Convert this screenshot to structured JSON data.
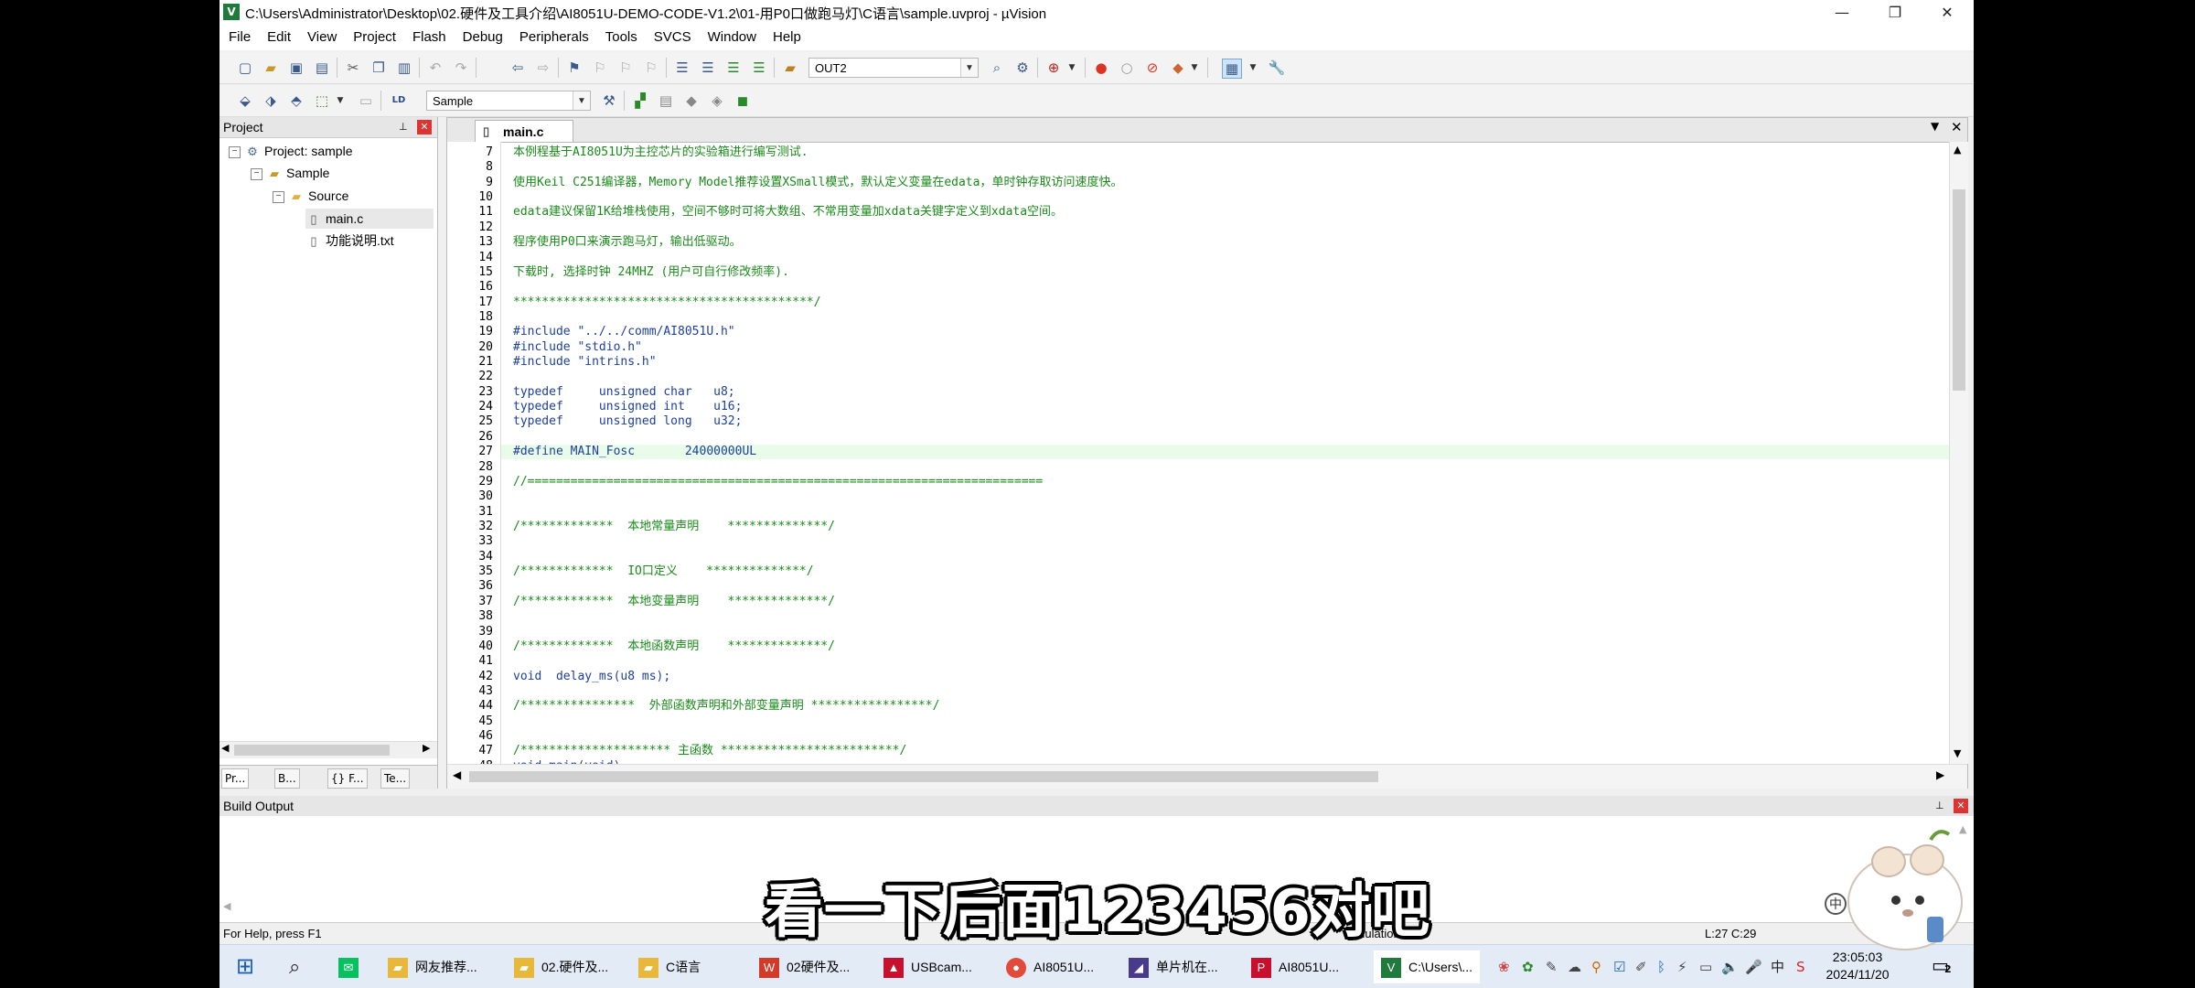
{
  "window": {
    "title": "C:\\Users\\Administrator\\Desktop\\02.硬件及工具介绍\\AI8051U-DEMO-CODE-V1.2\\01-用P0口做跑马灯\\C语言\\sample.uvproj - µVision",
    "minimize": "—",
    "maximize": "❐",
    "close": "✕"
  },
  "menu": [
    "File",
    "Edit",
    "View",
    "Project",
    "Flash",
    "Debug",
    "Peripherals",
    "Tools",
    "SVCS",
    "Window",
    "Help"
  ],
  "toolbar": {
    "target_combo": "OUT2",
    "target_select": "Sample"
  },
  "project": {
    "header": "Project",
    "root": "Project: sample",
    "group": "Sample",
    "folder": "Source",
    "files": [
      "main.c",
      "功能说明.txt"
    ],
    "tabs": [
      "Pr...",
      "B...",
      "{} F...",
      "Te..."
    ]
  },
  "editor": {
    "tab": "main.c",
    "cursor_line": 27,
    "lines": [
      {
        "n": "7",
        "cls": "c-green",
        "t": "本例程基于AI8051U为主控芯片的实验箱进行编写测试."
      },
      {
        "n": "8",
        "cls": "c-green",
        "t": ""
      },
      {
        "n": "9",
        "cls": "c-green",
        "t": "使用Keil C251编译器，Memory Model推荐设置XSmall模式，默认定义变量在edata，单时钟存取访问速度快。"
      },
      {
        "n": "10",
        "cls": "c-green",
        "t": ""
      },
      {
        "n": "11",
        "cls": "c-green",
        "t": "edata建议保留1K给堆栈使用，空间不够时可将大数组、不常用变量加xdata关键字定义到xdata空间。"
      },
      {
        "n": "12",
        "cls": "c-green",
        "t": ""
      },
      {
        "n": "13",
        "cls": "c-green",
        "t": "程序使用P0口来演示跑马灯，输出低驱动。"
      },
      {
        "n": "14",
        "cls": "c-green",
        "t": ""
      },
      {
        "n": "15",
        "cls": "c-green",
        "t": "下载时, 选择时钟 24MHZ (用户可自行修改频率)."
      },
      {
        "n": "16",
        "cls": "c-green",
        "t": ""
      },
      {
        "n": "17",
        "cls": "c-green",
        "t": "******************************************/"
      },
      {
        "n": "18",
        "cls": "c-black",
        "t": ""
      },
      {
        "n": "19",
        "cls": "c-blue",
        "t": "#include \"../../comm/AI8051U.h\""
      },
      {
        "n": "20",
        "cls": "c-blue",
        "t": "#include \"stdio.h\""
      },
      {
        "n": "21",
        "cls": "c-blue",
        "t": "#include \"intrins.h\""
      },
      {
        "n": "22",
        "cls": "c-black",
        "t": ""
      },
      {
        "n": "23",
        "cls": "c-blue",
        "t": "typedef     unsigned char   u8;"
      },
      {
        "n": "24",
        "cls": "c-blue",
        "t": "typedef     unsigned int    u16;"
      },
      {
        "n": "25",
        "cls": "c-blue",
        "t": "typedef     unsigned long   u32;"
      },
      {
        "n": "26",
        "cls": "c-black",
        "t": ""
      },
      {
        "n": "27",
        "cls": "c-blue",
        "t": "#define MAIN_Fosc       24000000UL"
      },
      {
        "n": "28",
        "cls": "c-black",
        "t": ""
      },
      {
        "n": "29",
        "cls": "c-green",
        "t": "//========================================================================"
      },
      {
        "n": "30",
        "cls": "c-black",
        "t": ""
      },
      {
        "n": "31",
        "cls": "c-black",
        "t": ""
      },
      {
        "n": "32",
        "cls": "c-green",
        "t": "/*************  本地常量声明    **************/"
      },
      {
        "n": "33",
        "cls": "c-black",
        "t": ""
      },
      {
        "n": "34",
        "cls": "c-black",
        "t": ""
      },
      {
        "n": "35",
        "cls": "c-green",
        "t": "/*************  IO口定义    **************/"
      },
      {
        "n": "36",
        "cls": "c-black",
        "t": ""
      },
      {
        "n": "37",
        "cls": "c-green",
        "t": "/*************  本地变量声明    **************/"
      },
      {
        "n": "38",
        "cls": "c-black",
        "t": ""
      },
      {
        "n": "39",
        "cls": "c-black",
        "t": ""
      },
      {
        "n": "40",
        "cls": "c-green",
        "t": "/*************  本地函数声明    **************/"
      },
      {
        "n": "41",
        "cls": "c-black",
        "t": ""
      },
      {
        "n": "42",
        "cls": "c-blue",
        "t": "void  delay_ms(u8 ms);"
      },
      {
        "n": "43",
        "cls": "c-black",
        "t": ""
      },
      {
        "n": "44",
        "cls": "c-green",
        "t": "/****************  外部函数声明和外部变量声明 *****************/"
      },
      {
        "n": "45",
        "cls": "c-black",
        "t": ""
      },
      {
        "n": "46",
        "cls": "c-black",
        "t": ""
      },
      {
        "n": "47",
        "cls": "c-green",
        "t": "/********************* 主函数 *************************/"
      },
      {
        "n": "48",
        "cls": "c-blue",
        "t": "void main(void)"
      }
    ]
  },
  "build_output": {
    "header": "Build Output"
  },
  "status": {
    "help": "For Help, press F1",
    "mode": "Simulation",
    "position": "L:27 C:29"
  },
  "taskbar": {
    "items": [
      "网友推荐...",
      "02.硬件及...",
      "C语言",
      "02硬件及...",
      "USBcam...",
      "AI8051U...",
      "单片机在...",
      "AI8051U...",
      "C:\\Users\\..."
    ],
    "time": "23:05:03",
    "date": "2024/11/20",
    "ime": "中",
    "notify_count": "2"
  },
  "subtitle": "看一下后面123456对吧",
  "colors": {
    "comment": "#1a8a1a",
    "keyword": "#1d3f9e",
    "current_line": "#e9fbe9"
  }
}
